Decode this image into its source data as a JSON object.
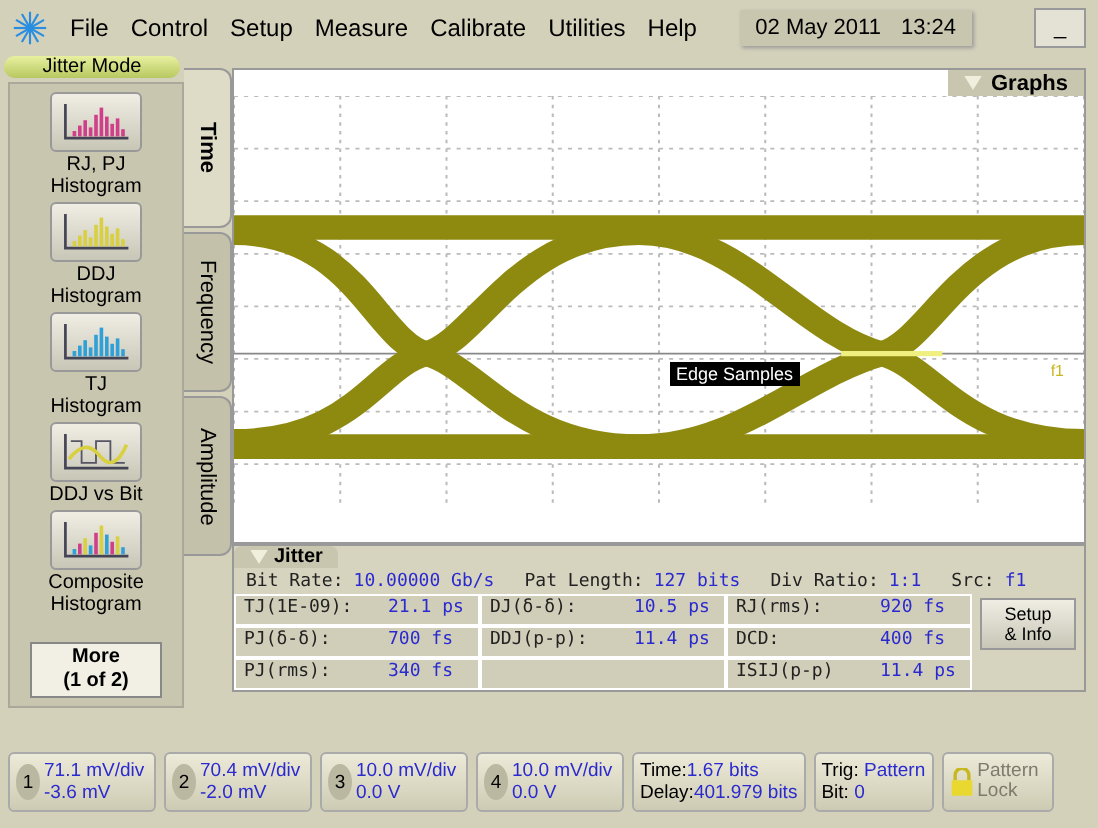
{
  "menu": [
    "File",
    "Control",
    "Setup",
    "Measure",
    "Calibrate",
    "Utilities",
    "Help"
  ],
  "datetime": {
    "date": "02 May 2011",
    "time": "13:24"
  },
  "minimize": "_",
  "mode_label": "Jitter Mode",
  "tool_buttons": [
    {
      "kind": "rjpj",
      "label": "RJ, PJ Histogram"
    },
    {
      "kind": "ddj",
      "label": "DDJ Histogram"
    },
    {
      "kind": "tj",
      "label": "TJ Histogram"
    },
    {
      "kind": "ddjbit",
      "label": "DDJ vs Bit"
    },
    {
      "kind": "composite",
      "label": "Composite Histogram"
    }
  ],
  "more_button": "More\n(1 of 2)",
  "tabs": [
    {
      "label": "Time",
      "selected": true
    },
    {
      "label": "Frequency",
      "selected": false
    },
    {
      "label": "Amplitude",
      "selected": false
    }
  ],
  "graphs_tab": "Graphs",
  "edge_label": "Edge Samples",
  "marker_label": "f1",
  "jitter": {
    "title": "Jitter",
    "summary": [
      {
        "label": "Bit Rate:",
        "value": "10.00000 Gb/s"
      },
      {
        "label": "Pat Length:",
        "value": "127 bits"
      },
      {
        "label": "Div Ratio:",
        "value": "1:1"
      },
      {
        "label": "Src:",
        "value": "f1"
      }
    ],
    "rows": [
      [
        {
          "label": "TJ(1E-09):",
          "value": "21.1 ps"
        },
        {
          "label": "DJ(δ-δ):",
          "value": "10.5 ps"
        },
        {
          "label": "RJ(rms):",
          "value": "920 fs"
        }
      ],
      [
        {
          "label": "PJ(δ-δ):",
          "value": "700 fs"
        },
        {
          "label": "DDJ(p-p):",
          "value": "11.4 ps"
        },
        {
          "label": "DCD:",
          "value": "400 fs"
        }
      ],
      [
        {
          "label": "PJ(rms):",
          "value": "340 fs"
        },
        null,
        {
          "label": "ISIJ(p-p)",
          "value": "11.4 ps"
        }
      ]
    ],
    "setup_button": "Setup\n& Info"
  },
  "channels": [
    {
      "number": "1",
      "scale": "71.1 mV/div",
      "offset": "-3.6 mV"
    },
    {
      "number": "2",
      "scale": "70.4 mV/div",
      "offset": "-2.0 mV"
    },
    {
      "number": "3",
      "scale": "10.0 mV/div",
      "offset": "0.0 V"
    },
    {
      "number": "4",
      "scale": "10.0 mV/div",
      "offset": "0.0 V"
    }
  ],
  "timebase": [
    {
      "label": "Time:",
      "value": "1.67 bits"
    },
    {
      "label": "Delay:",
      "value": "401.979 bits"
    }
  ],
  "trigger": [
    {
      "label": "Trig:",
      "value": "Pattern"
    },
    {
      "label": "Bit:",
      "value": "0"
    }
  ],
  "pattern_lock": {
    "label": "Pattern\nLock",
    "disabled": true
  }
}
